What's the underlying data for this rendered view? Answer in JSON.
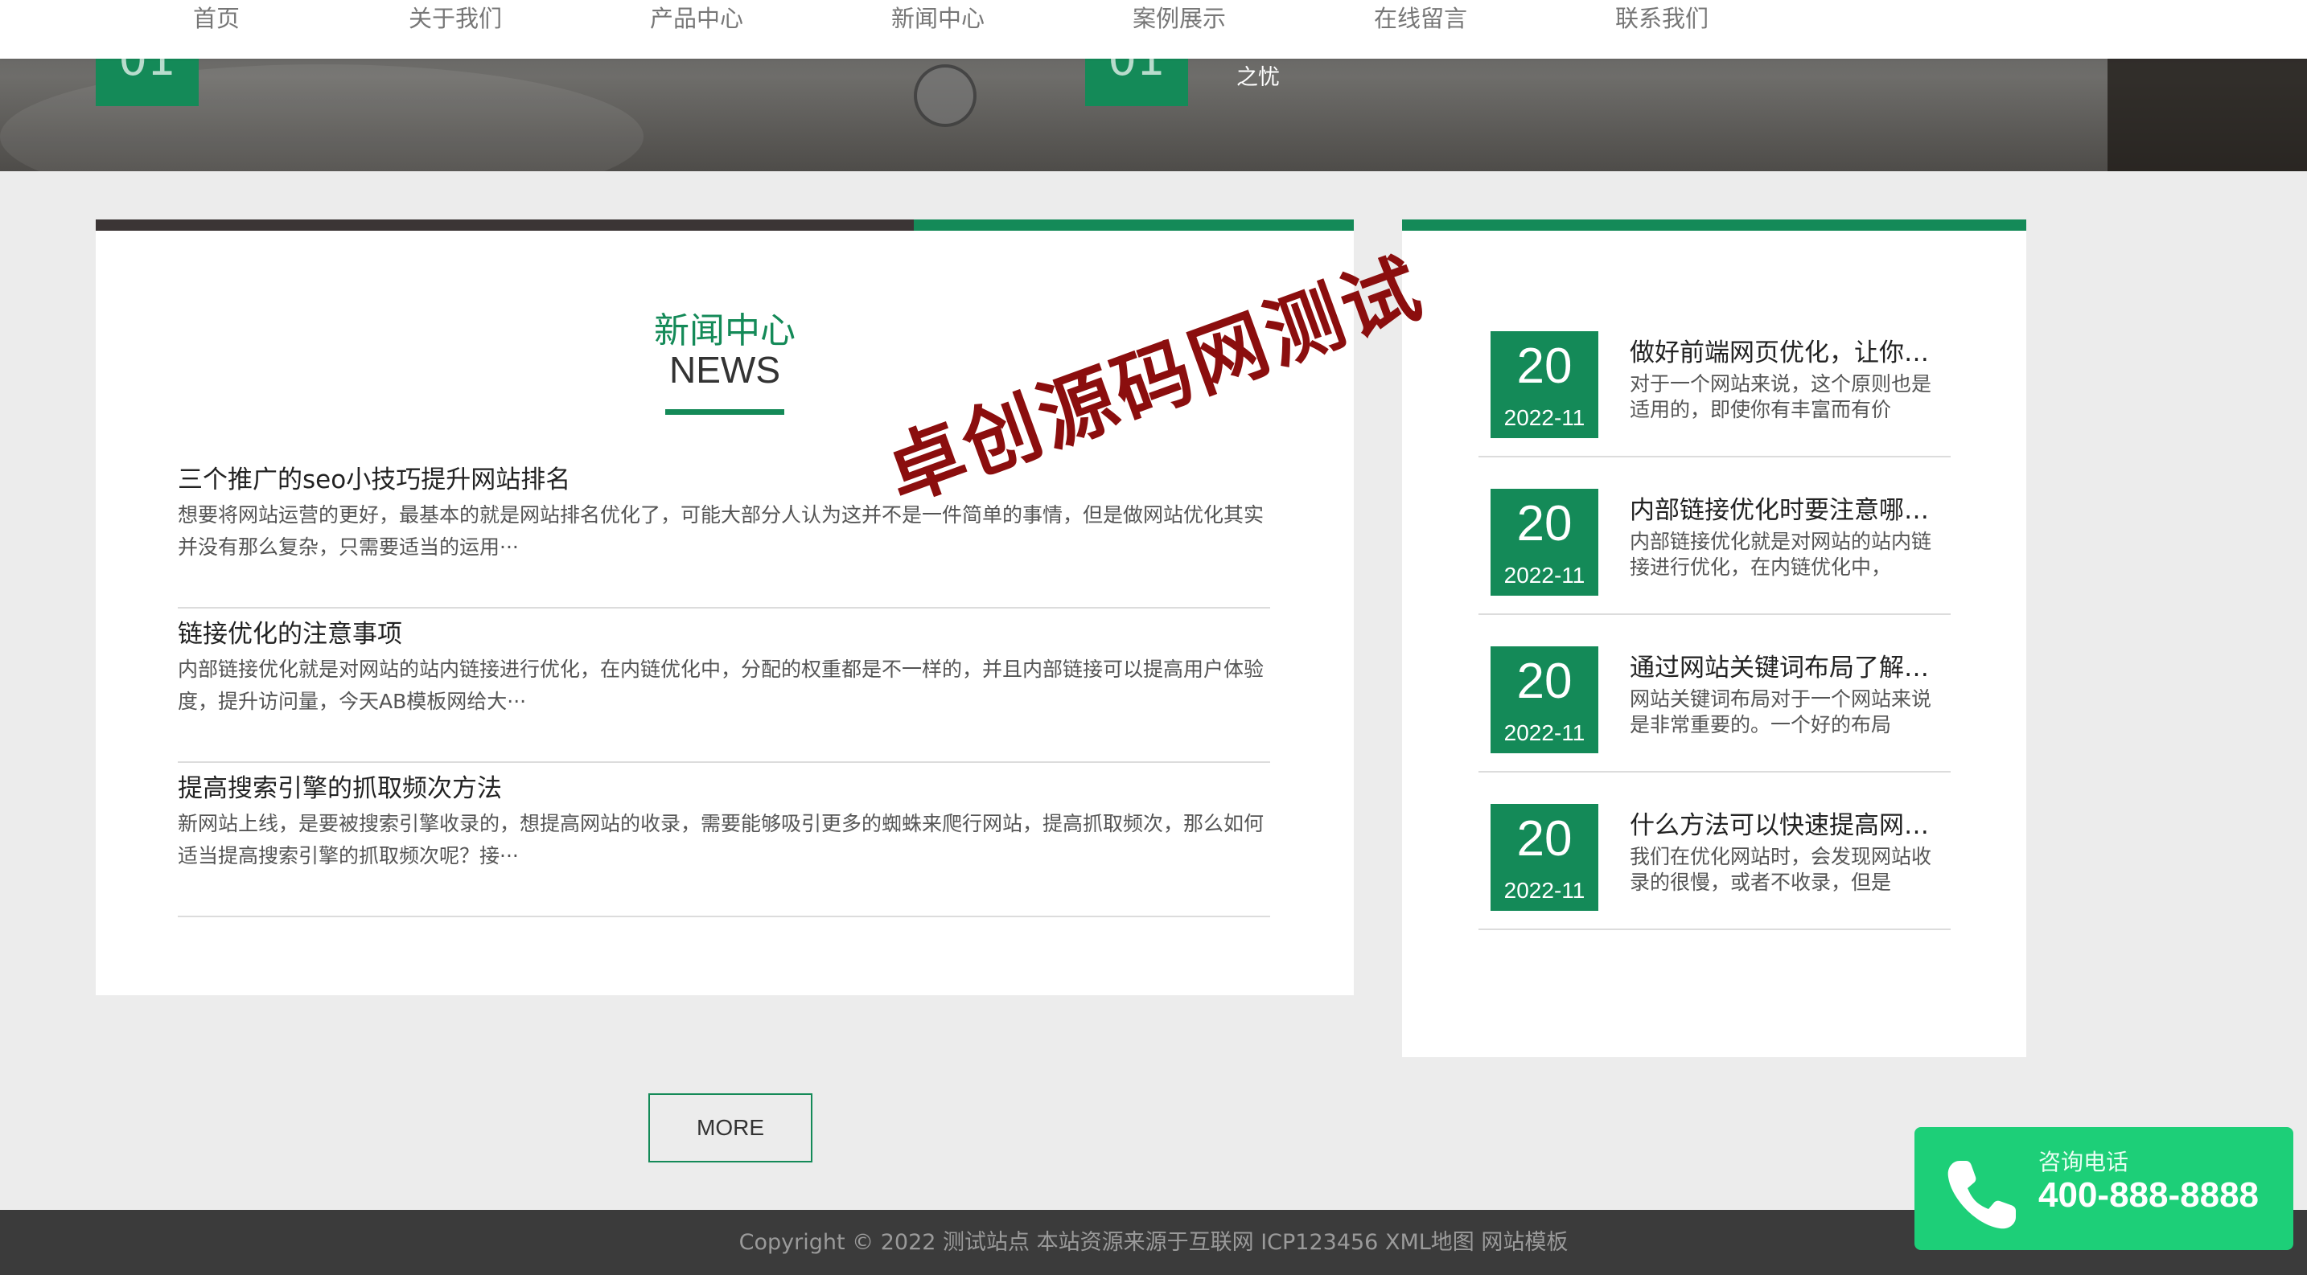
{
  "nav": {
    "items": [
      "首页",
      "关于我们",
      "产品中心",
      "新闻中心",
      "案例展示",
      "在线留言",
      "联系我们"
    ]
  },
  "hero": {
    "badges": [
      "01",
      "01"
    ],
    "right_text_tail": "之忧"
  },
  "news": {
    "title": "新闻中心",
    "subtitle": "NEWS",
    "articles": [
      {
        "title": "三个推广的seo小技巧提升网站排名",
        "desc": "想要将网站运营的更好，最基本的就是网站排名优化了，可能大部分人认为这并不是一件简单的事情，但是做网站优化其实并没有那么复杂，只需要适当的运用···"
      },
      {
        "title": "链接优化的注意事项",
        "desc": "内部链接优化就是对网站的站内链接进行优化，在内链优化中，分配的权重都是不一样的，并且内部链接可以提高用户体验度，提升访问量，今天AB模板网给大···"
      },
      {
        "title": "提高搜索引擎的抓取频次方法",
        "desc": "新网站上线，是要被搜索引擎收录的，想提高网站的收录，需要能够吸引更多的蜘蛛来爬行网站，提高抓取频次，那么如何适当提高搜索引擎的抓取频次呢？接···"
      }
    ],
    "more_label": "MORE"
  },
  "side": {
    "items": [
      {
        "day": "20",
        "ym": "2022-11",
        "title": "做好前端网页优化，让你…",
        "desc": "对于一个网站来说，这个原则也是适用的，即使你有丰富而有价"
      },
      {
        "day": "20",
        "ym": "2022-11",
        "title": "内部链接优化时要注意哪…",
        "desc": "内部链接优化就是对网站的站内链接进行优化，在内链优化中，"
      },
      {
        "day": "20",
        "ym": "2022-11",
        "title": "通过网站关键词布局了解…",
        "desc": "网站关键词布局对于一个网站来说是非常重要的。一个好的布局"
      },
      {
        "day": "20",
        "ym": "2022-11",
        "title": "什么方法可以快速提高网…",
        "desc": "我们在优化网站时，会发现网站收录的很慢，或者不收录，但是"
      }
    ]
  },
  "watermark": "卓创源码网测试",
  "footer": {
    "copyright": "Copyright © 2022 测试站点 本站资源来源于互联网 ICP123456 XML地图 网站模板"
  },
  "contact": {
    "label": "咨询电话",
    "phone": "400-888-8888",
    "icon": "phone-icon"
  },
  "colors": {
    "accent": "#148a58",
    "dark": "#3b3535",
    "phone_green": "#1dcf78",
    "watermark": "#8b0e0e"
  }
}
